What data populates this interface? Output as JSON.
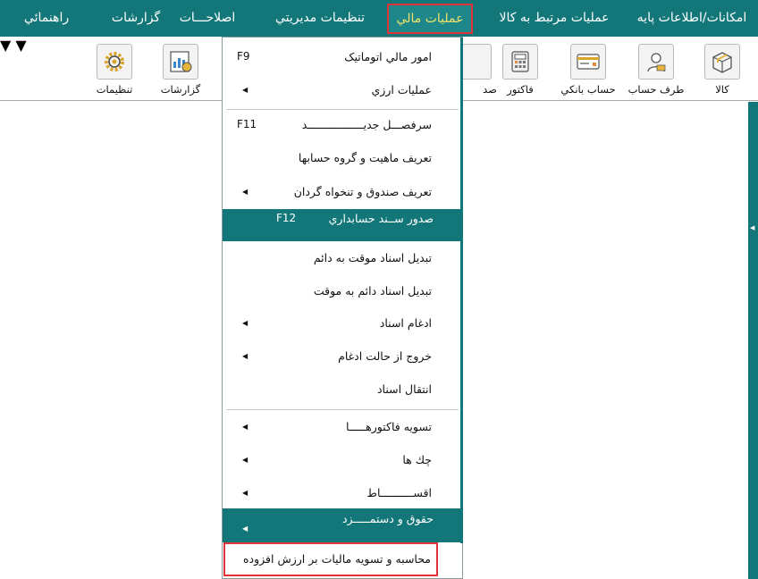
{
  "menubar": {
    "items": [
      {
        "label": "راهنمائي"
      },
      {
        "label": "گزارشات"
      },
      {
        "label": "اصلاحـــات"
      },
      {
        "label": "تنظيمات مديريتي"
      },
      {
        "label": "عمليات مالي"
      },
      {
        "label": "عمليات مرتبط به کالا"
      },
      {
        "label": "امکانات/اطلاعات پايه"
      }
    ]
  },
  "toolbar": {
    "settings_label": "تنظيمات",
    "reports_label": "گزارشات",
    "voucher_label_partial": "صد",
    "invoice_label": "فاکتور",
    "bank_label": "حساب بانکي",
    "party_label": "طرف حساب",
    "goods_label": "کالا"
  },
  "dropdown": {
    "items": [
      {
        "label": "امور مالي اتوماتيک",
        "shortcut": "F9"
      },
      {
        "label": "عمليات ارزي"
      },
      {
        "label": "سرفصـــل جديـــــــــــــــــد",
        "shortcut": "F11"
      },
      {
        "label": "تعريف ماهيت و گروه حسابها"
      },
      {
        "label": "تعريف صندوق و تنخواه گردان"
      },
      {
        "label": "صدور ســند حسابداري",
        "shortcut": "F12"
      },
      {
        "label": "تبديل اسناد موقت به دائم"
      },
      {
        "label": "تبديل اسناد دائم به موقت"
      },
      {
        "label": "ادغام اسناد"
      },
      {
        "label": "خروج از حالت ادغام"
      },
      {
        "label": "انتقال اسناد"
      },
      {
        "label": "تسويه فاکتورهـــــا"
      },
      {
        "label": "چك ها"
      },
      {
        "label": "اقســــــــــاط"
      },
      {
        "label": "حقوق و دستمـــــزد"
      },
      {
        "label": "محاسبه و تسويه ماليات بر ارزش افزوده"
      }
    ]
  },
  "colors": {
    "teal": "#13777a",
    "active_text": "#f1e36b",
    "highlight_border": "#e0343a"
  }
}
